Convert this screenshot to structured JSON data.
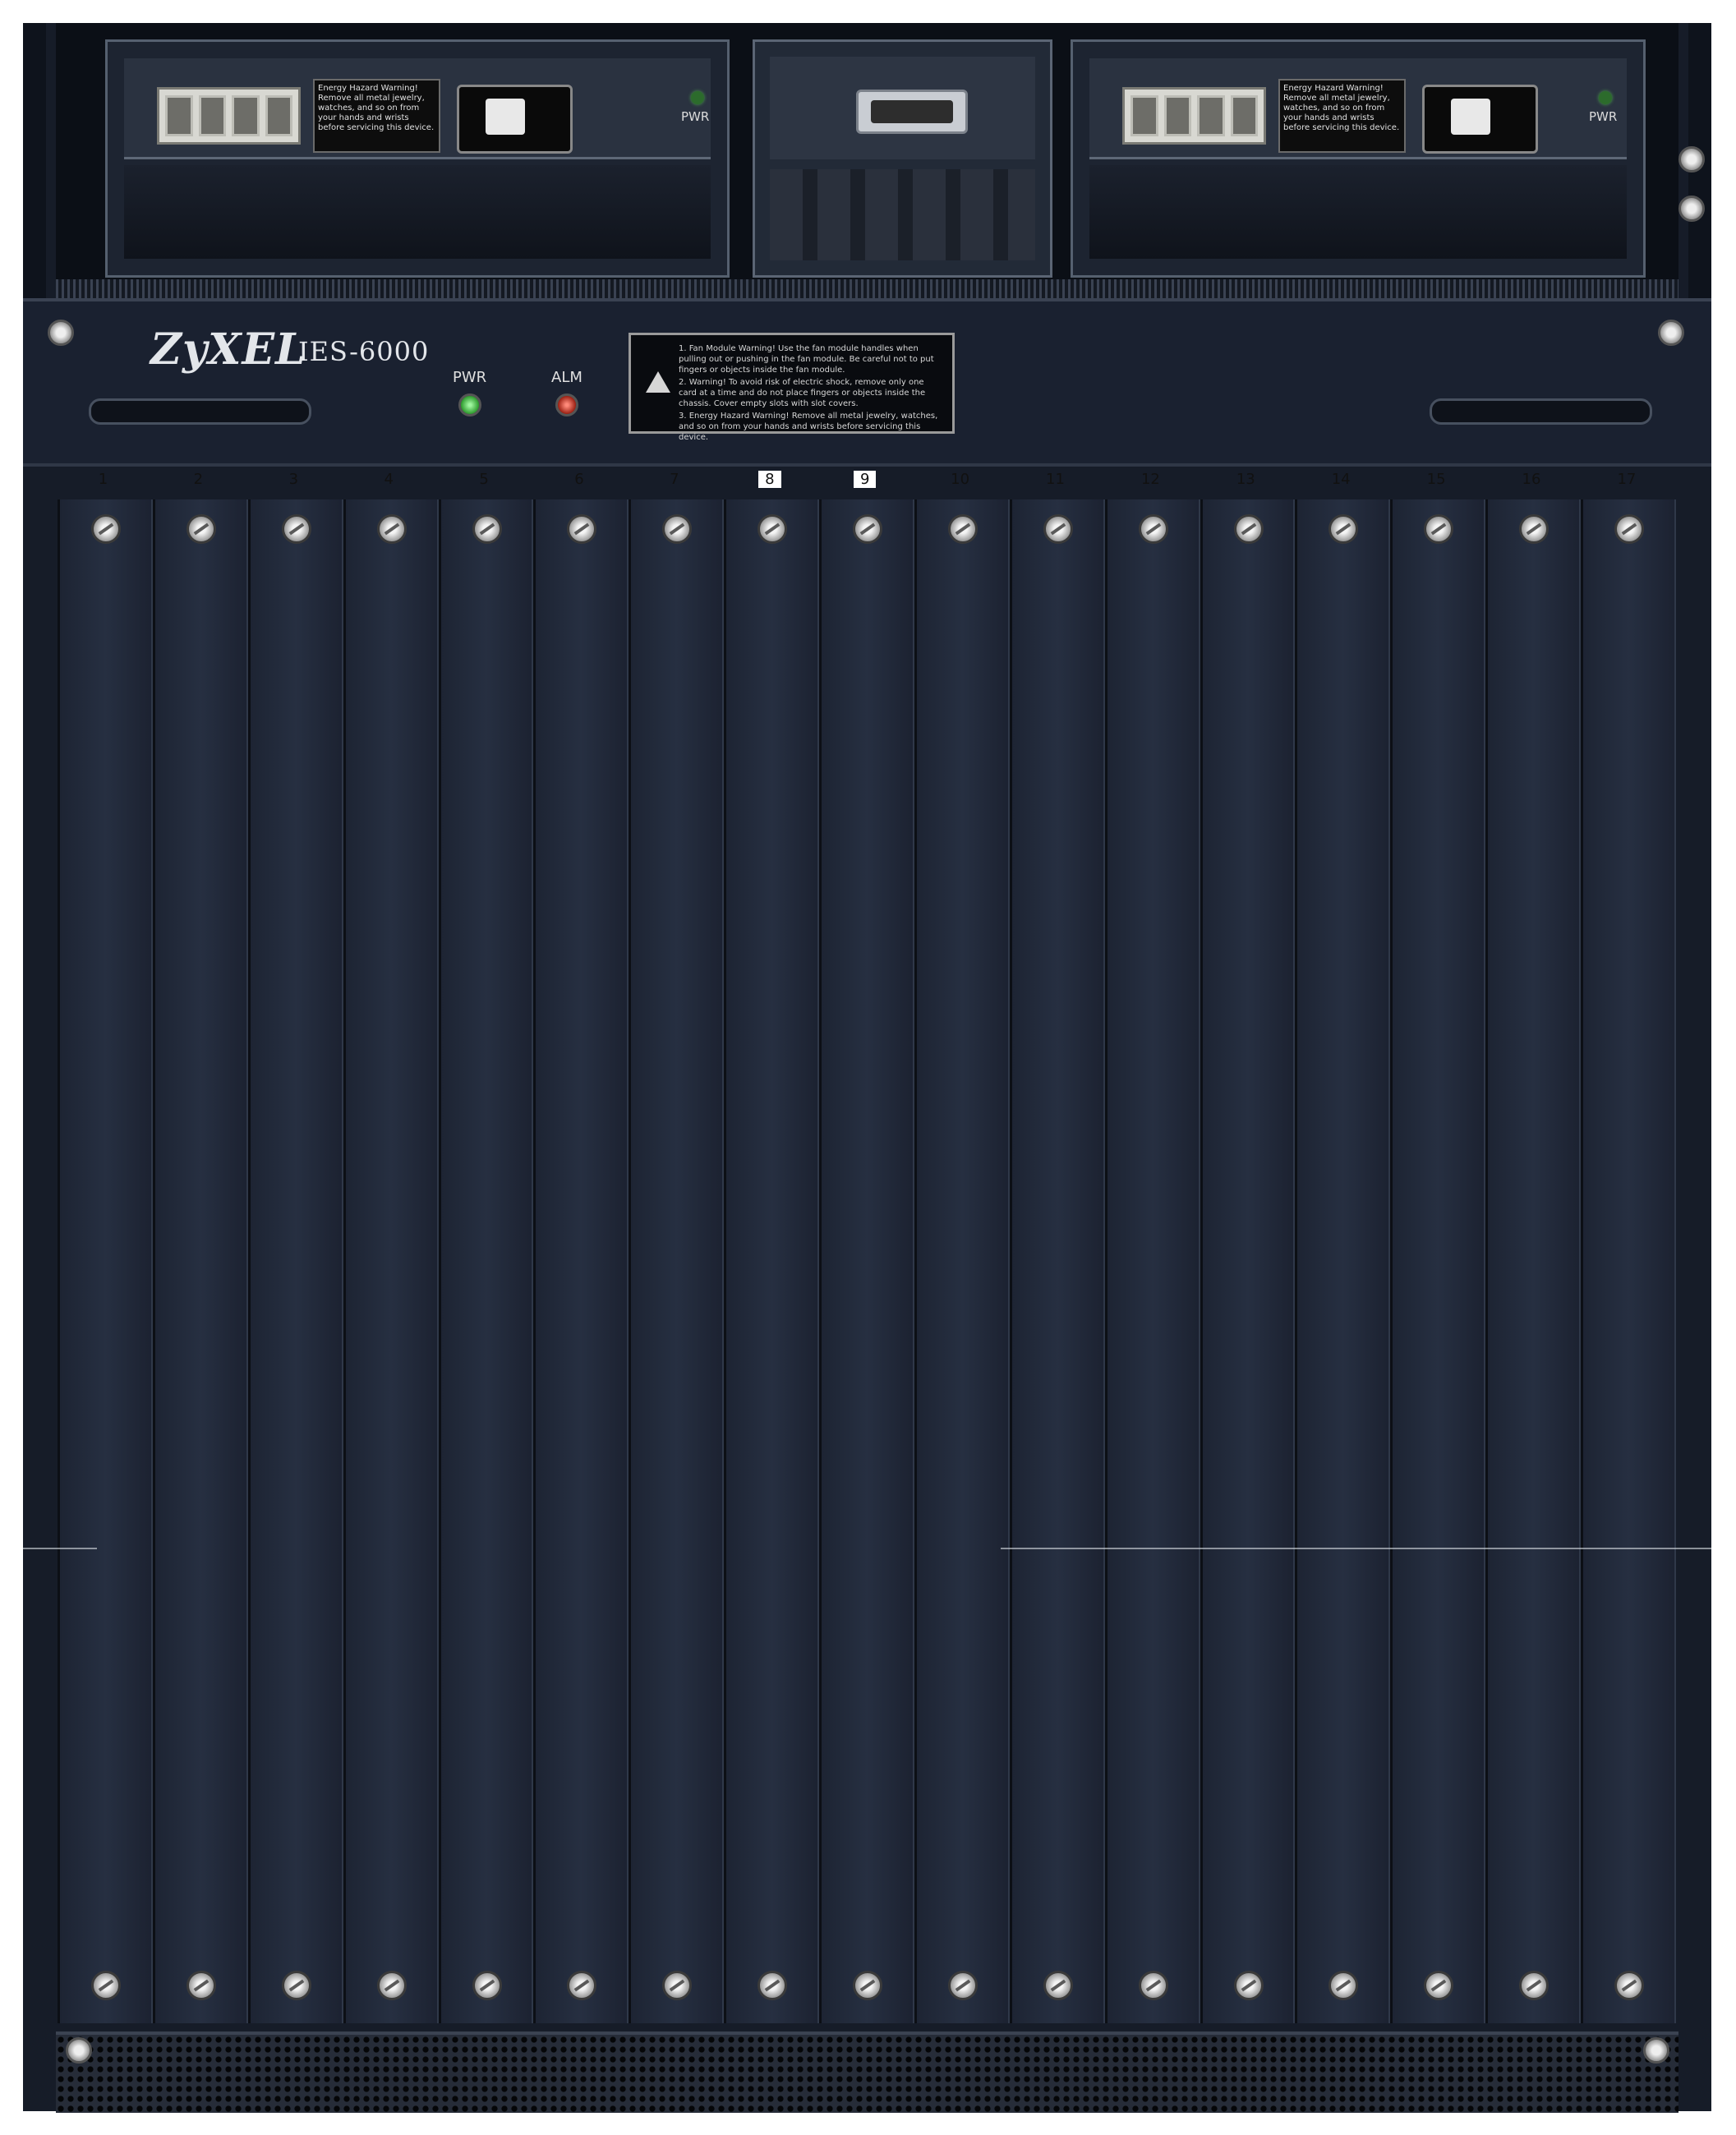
{
  "device": {
    "brand": "ZyXEL",
    "model": "IES-6000",
    "status_leds": [
      {
        "label": "PWR",
        "color": "#3cd23c"
      },
      {
        "label": "ALM",
        "color": "#d43322"
      }
    ],
    "warning_label": [
      "1. Fan Module Warning! Use the fan module handles when pulling out or pushing in the fan module. Be careful not to put fingers or objects inside the fan module.",
      "2. Warning! To avoid risk of electric shock, remove only one card at a time and do not place fingers or objects inside the chassis. Cover empty slots with slot covers.",
      "3. Energy Hazard Warning! Remove all metal jewelry, watches, and so on from your hands and wrists before servicing this device."
    ]
  },
  "power_supplies": [
    {
      "led_label": "PWR",
      "warning": "Energy Hazard Warning! Remove all metal jewelry, watches, and so on from your hands and wrists before servicing this device."
    },
    {
      "led_label": "PWR",
      "warning": "Energy Hazard Warning! Remove all metal jewelry, watches, and so on from your hands and wrists before servicing this device."
    }
  ],
  "slots": [
    "1",
    "2",
    "3",
    "4",
    "5",
    "6",
    "7",
    "8",
    "9",
    "10",
    "11",
    "12",
    "13",
    "14",
    "15",
    "16",
    "17"
  ],
  "highlighted_slots": [
    "8",
    "9"
  ]
}
